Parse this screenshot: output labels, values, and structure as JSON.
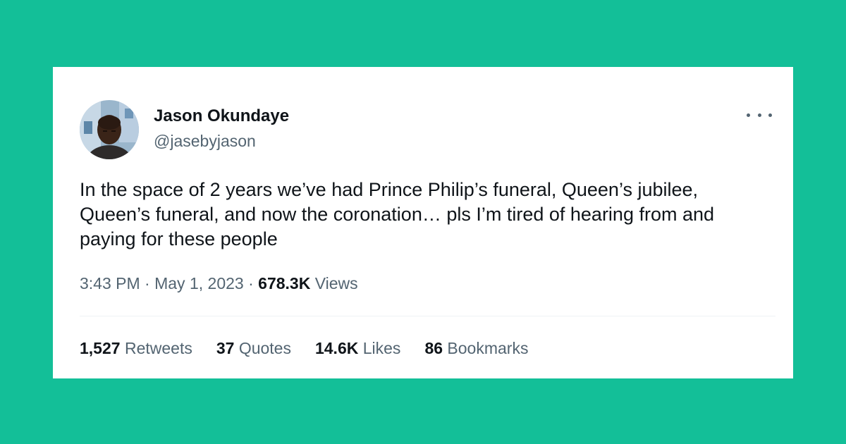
{
  "author": {
    "name": "Jason Okundaye",
    "handle": "@jasebyjason"
  },
  "tweet": {
    "text": "In the space of 2 years we’ve had Prince Philip’s funeral, Queen’s jubilee, Queen’s funeral, and now the coronation… pls I’m tired of hearing from and paying for these people",
    "time": "3:43 PM",
    "separator": "·",
    "date": "May 1, 2023",
    "views_count": "678.3K",
    "views_label": "Views"
  },
  "stats": {
    "retweets_count": "1,527",
    "retweets_label": "Retweets",
    "quotes_count": "37",
    "quotes_label": "Quotes",
    "likes_count": "14.6K",
    "likes_label": "Likes",
    "bookmarks_count": "86",
    "bookmarks_label": "Bookmarks"
  },
  "icons": {
    "more": "more-options-icon",
    "avatar": "profile-photo"
  },
  "colors": {
    "background": "#13bf98",
    "card": "#ffffff",
    "primary_text": "#0f1419",
    "secondary_text": "#536471"
  }
}
